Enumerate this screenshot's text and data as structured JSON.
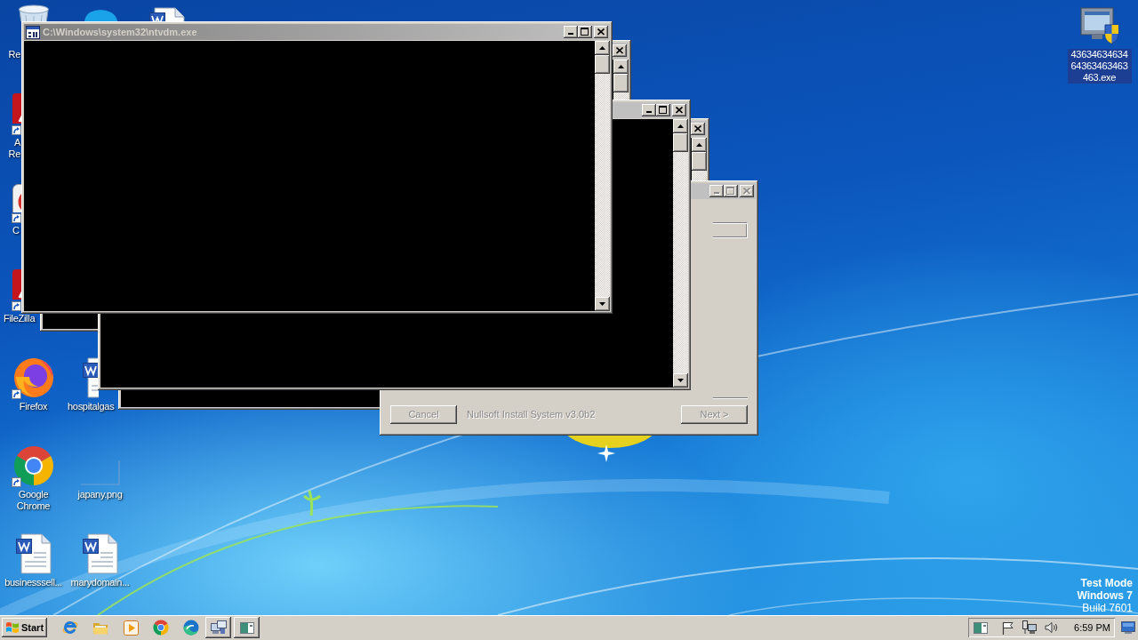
{
  "desktop_icons": [
    {
      "kind": "recycle-bin",
      "label": "Re",
      "shortcut": false,
      "selected": false
    },
    {
      "kind": "tile-app",
      "label": "A Re",
      "shortcut": true,
      "selected": false
    },
    {
      "kind": "app",
      "label": "C",
      "shortcut": true,
      "selected": false
    },
    {
      "kind": "tile-app",
      "label": "FileZilla",
      "shortcut": true,
      "selected": false
    },
    {
      "kind": "firefox",
      "label": "Firefox",
      "shortcut": true,
      "selected": false
    },
    {
      "kind": "chrome",
      "label": "Google Chrome",
      "shortcut": true,
      "selected": false
    },
    {
      "kind": "word-doc",
      "label": "businesssell...",
      "shortcut": false,
      "selected": false
    },
    {
      "kind": "cloud-app"
    },
    {
      "kind": "word-doc",
      "label": "hospitalgas",
      "shortcut": false,
      "selected": false
    },
    {
      "kind": "image",
      "label": "japany.png",
      "shortcut": false,
      "selected": false
    },
    {
      "kind": "word-doc",
      "label": "marydomain...",
      "shortcut": false,
      "selected": false
    },
    {
      "kind": "word-doc"
    },
    {
      "kind": "monitor-shield",
      "label": "4363463463464363463463463.exe",
      "shortcut": false,
      "selected": true
    }
  ],
  "windows": [
    {
      "kind": "console",
      "active": false,
      "title": "C:\\Windows\\system32\\ntvdm.exe",
      "controls": [
        {
          "kind": "minimize",
          "disabled": false
        },
        {
          "kind": "maximize",
          "disabled": false
        },
        {
          "kind": "close",
          "disabled": false
        }
      ],
      "scroll_arrows": [
        {
          "kind": "up"
        },
        {
          "kind": "down"
        }
      ]
    },
    {
      "kind": "console",
      "active": false,
      "controls": [
        {
          "kind": "minimize",
          "disabled": false
        },
        {
          "kind": "maximize",
          "disabled": false
        },
        {
          "kind": "close",
          "disabled": false
        }
      ],
      "scroll_arrows": [
        {
          "kind": "up"
        },
        {
          "kind": "down"
        }
      ]
    },
    {
      "kind": "console",
      "active": false,
      "controls": [
        {
          "kind": "close",
          "disabled": false
        }
      ],
      "scroll_arrows": [
        {
          "kind": "up"
        }
      ]
    },
    {
      "kind": "installer",
      "active": false,
      "controls": [
        {
          "kind": "minimize",
          "disabled": true
        },
        {
          "kind": "maximize",
          "disabled": true
        },
        {
          "kind": "close",
          "disabled": true
        }
      ],
      "buttons": [
        {
          "label": "Cancel",
          "disabled": true
        },
        {
          "label": "Next >",
          "disabled": true
        }
      ],
      "branding": "Nullsoft Install System v3.0b2"
    },
    {
      "kind": "console",
      "active": false,
      "controls": [
        {
          "kind": "close",
          "disabled": false
        }
      ],
      "scroll_arrows": [
        {
          "kind": "up"
        }
      ]
    }
  ],
  "test_mode": [
    {
      "text": "Test Mode",
      "bold": true
    },
    {
      "text": "Windows 7",
      "bold": true
    },
    {
      "text": "Build 7601",
      "bold": false
    }
  ],
  "taskbar": {
    "start_label": "Start",
    "tasks": [
      {
        "kind": "computers",
        "selected": false
      },
      {
        "kind": "window",
        "selected": false
      }
    ],
    "clock": "6:59 PM"
  }
}
